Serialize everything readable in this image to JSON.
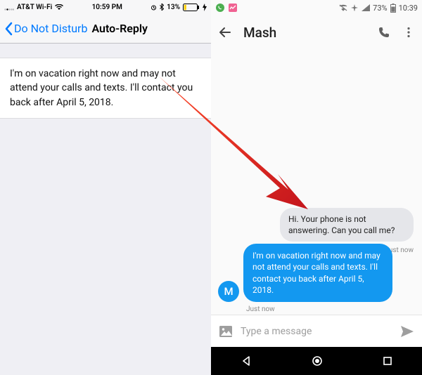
{
  "ios": {
    "status": {
      "carrier": "AT&T Wi-Fi",
      "time": "10:59 PM",
      "battery": "13%"
    },
    "back_label": "Do Not Disturb",
    "title": "Auto-Reply",
    "message": "I'm on vacation right now and may not attend your calls and texts. I'll contact you back after April 5, 2018."
  },
  "android": {
    "status": {
      "battery": "73%",
      "time": "10:39"
    },
    "contact_name": "Mash",
    "avatar_initial": "M",
    "incoming": {
      "text": "Hi. Your phone is not answering. Can you call me?",
      "time": "Just now"
    },
    "outgoing": {
      "text": "I'm on vacation right now and may not attend your calls and texts. I'll contact you back after April 5, 2018.",
      "time": "Just now"
    },
    "composer_placeholder": "Type a message"
  }
}
